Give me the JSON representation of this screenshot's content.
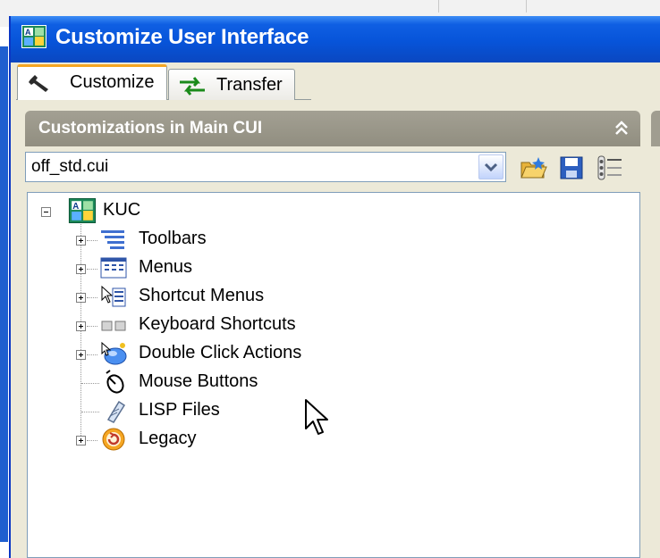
{
  "window": {
    "title": "Customize User Interface"
  },
  "tabs": [
    {
      "label": "Customize",
      "active": true,
      "icon": "wrench-icon"
    },
    {
      "label": "Transfer",
      "active": false,
      "icon": "transfer-arrows-icon"
    }
  ],
  "panel": {
    "title": "Customizations in Main CUI",
    "file_value": "off_std.cui"
  },
  "toolbar": {
    "icons": [
      "open-file-icon",
      "save-icon",
      "display-filters-icon"
    ]
  },
  "tree": {
    "root": {
      "label": "KUC",
      "icon": "cui-root-icon"
    },
    "children": [
      {
        "label": "Toolbars",
        "icon": "toolbars-icon",
        "expandable": true
      },
      {
        "label": "Menus",
        "icon": "menus-icon",
        "expandable": true
      },
      {
        "label": "Shortcut Menus",
        "icon": "shortcut-menus-icon",
        "expandable": true
      },
      {
        "label": "Keyboard Shortcuts",
        "icon": "keyboard-shortcuts-icon",
        "expandable": true
      },
      {
        "label": "Double Click Actions",
        "icon": "double-click-actions-icon",
        "expandable": true
      },
      {
        "label": "Mouse Buttons",
        "icon": "mouse-buttons-icon",
        "expandable": false
      },
      {
        "label": "LISP Files",
        "icon": "lisp-files-icon",
        "expandable": false
      },
      {
        "label": "Legacy",
        "icon": "legacy-icon",
        "expandable": true
      }
    ]
  },
  "colors": {
    "titlebar": "#0754d9",
    "panel_header": "#9a978a",
    "tab_highlight": "#f5a623",
    "window_bg": "#ece9d8"
  }
}
